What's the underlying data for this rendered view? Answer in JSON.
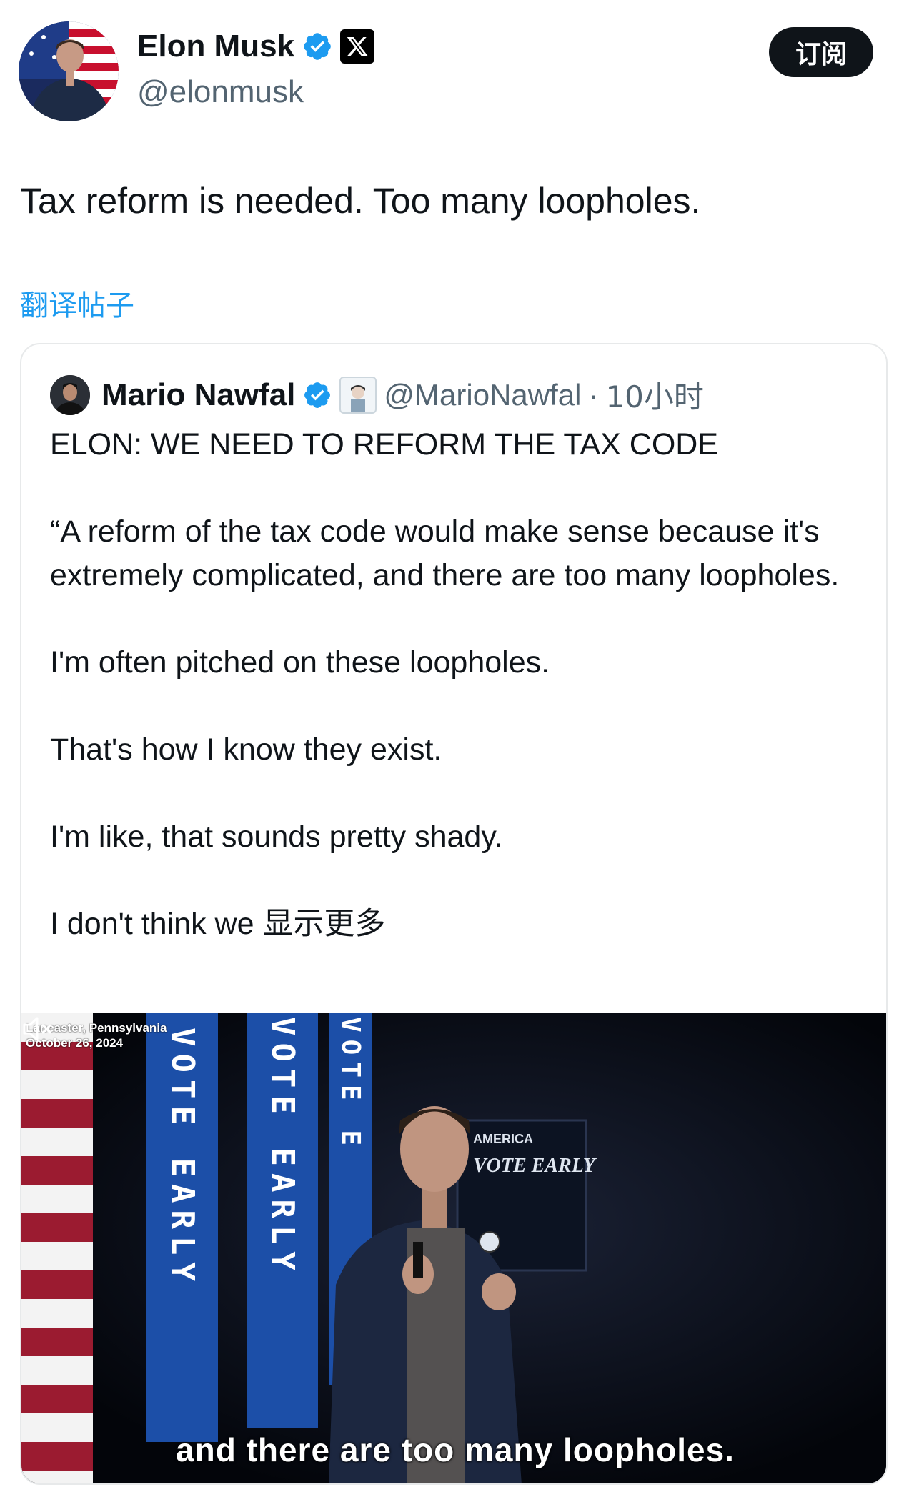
{
  "author": {
    "name": "Elon Musk",
    "handle": "@elonmusk",
    "verified_icon": "verified-badge-icon",
    "affiliation_icon": "x-logo-icon"
  },
  "subscribe_label": "订阅",
  "tweet": {
    "text": "Tax reform is needed. Too many loopholes.",
    "translate_label": "翻译帖子"
  },
  "quoted": {
    "name": "Mario Nawfal",
    "handle": "@MarioNawfal",
    "separator": "·",
    "time": "10小时",
    "headline": "ELON: WE NEED TO REFORM THE TAX CODE",
    "paragraphs": [
      "“A reform of the tax code would make sense because it's extremely complicated, and there are too many loopholes.",
      "I'm often pitched on these loopholes.",
      "That's how I know they exist.",
      "I'm like, that sounds pretty shady."
    ],
    "last_line": "I don't think we",
    "show_more": "显示更多"
  },
  "video": {
    "location": "Lancaster, Pennsylvania",
    "date": "October 26, 2024",
    "caption": "and there are too many loopholes.",
    "banner_text_1": "VOTE EARLY",
    "banner_text_2": "VOTE EARLY",
    "banner_text_3": "VOTE E",
    "sign_text_1": "AMERICA",
    "sign_text_2": "VOTE EARLY",
    "mute_icon": "volume-muted-icon"
  },
  "colors": {
    "link": "#1d9bf0",
    "verified": "#1d9bf0",
    "banner_blue": "#1c4fa8",
    "text": "#0f1419",
    "muted_text": "#536471"
  }
}
